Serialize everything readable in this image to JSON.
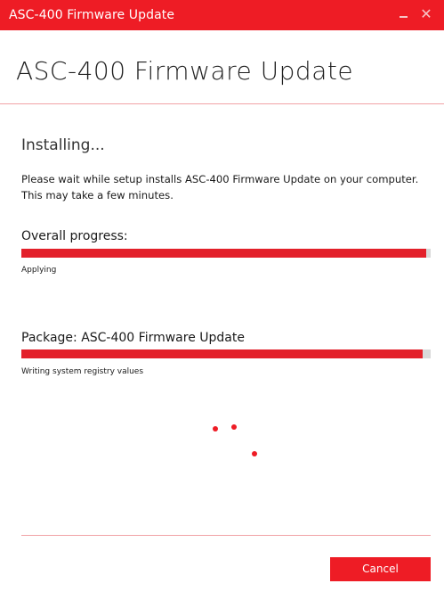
{
  "window": {
    "title": "ASC-400 Firmware Update",
    "minimize_icon": "minimize-icon",
    "close_icon": "close-icon",
    "close_glyph": "✕"
  },
  "heading": "ASC-400 Firmware Update",
  "status": {
    "title": "Installing...",
    "description": "Please wait while setup installs ASC-400 Firmware Update on your computer. This may take a few minutes."
  },
  "overall": {
    "label": "Overall progress:",
    "progress_fraction": 0.99,
    "action": "Applying"
  },
  "package": {
    "label": "Package: ASC-400 Firmware Update",
    "progress_fraction": 0.98,
    "action": "Writing system registry values"
  },
  "spinner": {
    "icon": "loading-spinner-icon"
  },
  "buttons": {
    "cancel": "Cancel"
  },
  "colors": {
    "accent": "#ee1c25",
    "progress_fill": "#e3202a",
    "progress_track": "#d9d9d9",
    "divider": "#f1a3a6"
  }
}
